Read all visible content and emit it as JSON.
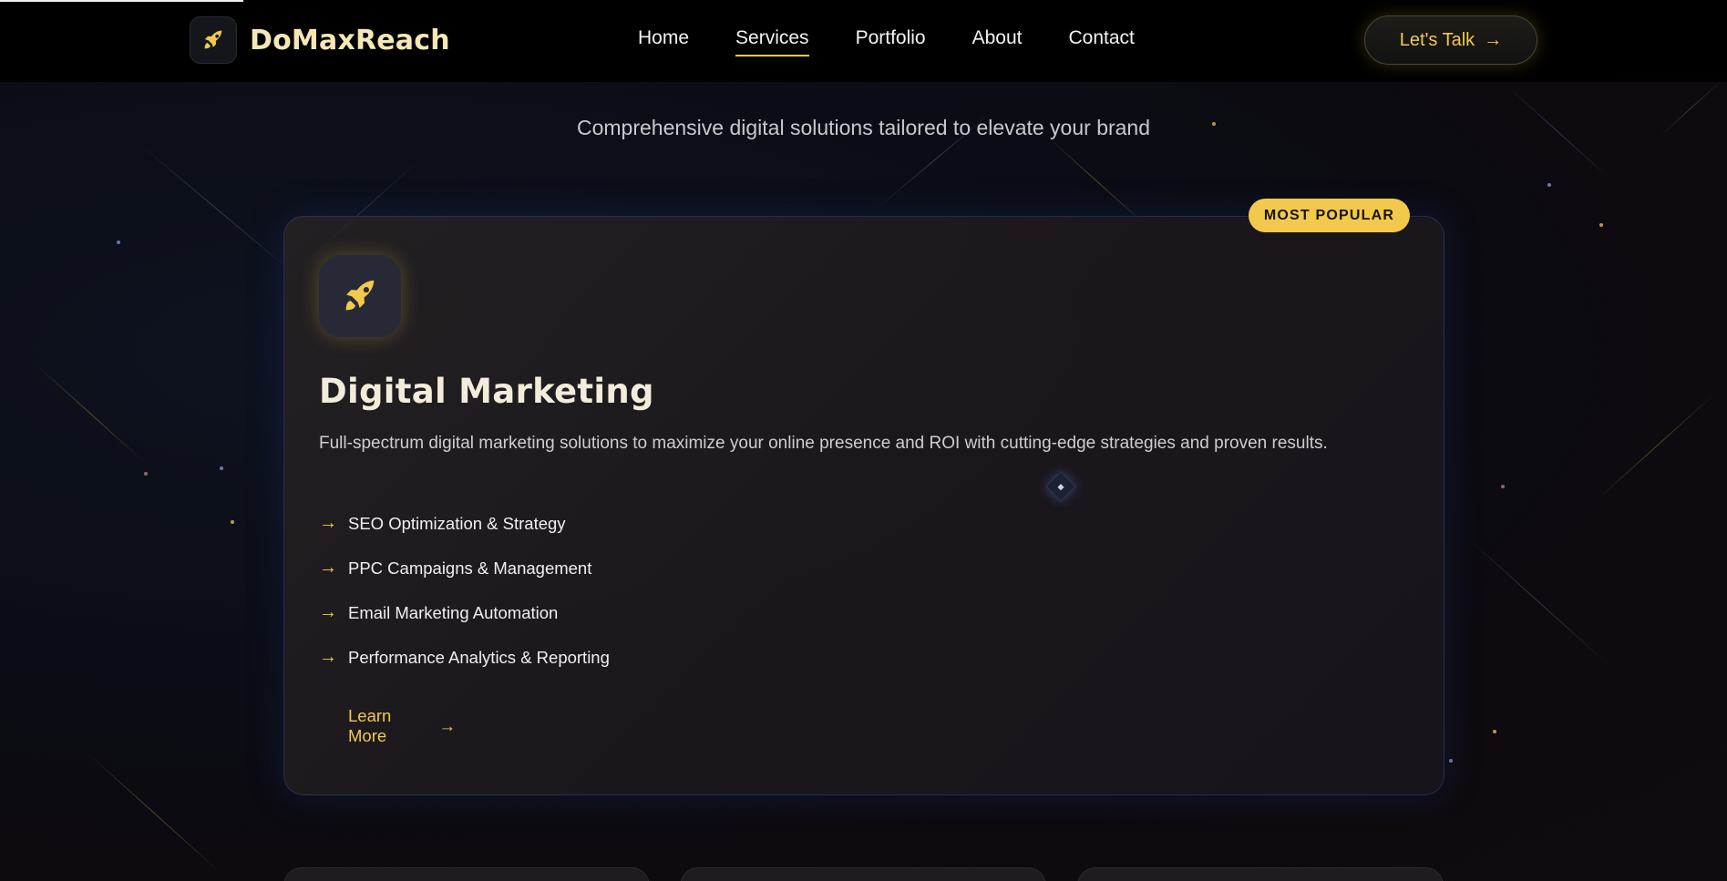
{
  "brand": {
    "name": "DoMaxReach",
    "icon": "rocket-icon",
    "accent": "#f2c94c"
  },
  "nav": {
    "items": [
      {
        "label": "Home",
        "active": false
      },
      {
        "label": "Services",
        "active": true
      },
      {
        "label": "Portfolio",
        "active": false
      },
      {
        "label": "About",
        "active": false
      },
      {
        "label": "Contact",
        "active": false
      }
    ],
    "cta_label": "Let's Talk",
    "cta_icon": "arrow-right-icon"
  },
  "section": {
    "subtitle": "Comprehensive digital solutions tailored to elevate your brand"
  },
  "service_card": {
    "badge": "MOST POPULAR",
    "icon": "rocket-icon",
    "title": "Digital Marketing",
    "description": "Full-spectrum digital marketing solutions to maximize your online presence and ROI with cutting-edge strategies and proven results.",
    "features": [
      "SEO Optimization & Strategy",
      "PPC Campaigns & Management",
      "Email Marketing Automation",
      "Performance Analytics & Reporting"
    ],
    "feature_bullet": "→",
    "button_label": "Learn More",
    "button_icon": "arrow-right-icon"
  },
  "colors": {
    "background": "#0b0d16",
    "accent": "#f2c94c",
    "card_border": "#2d4a8a"
  }
}
